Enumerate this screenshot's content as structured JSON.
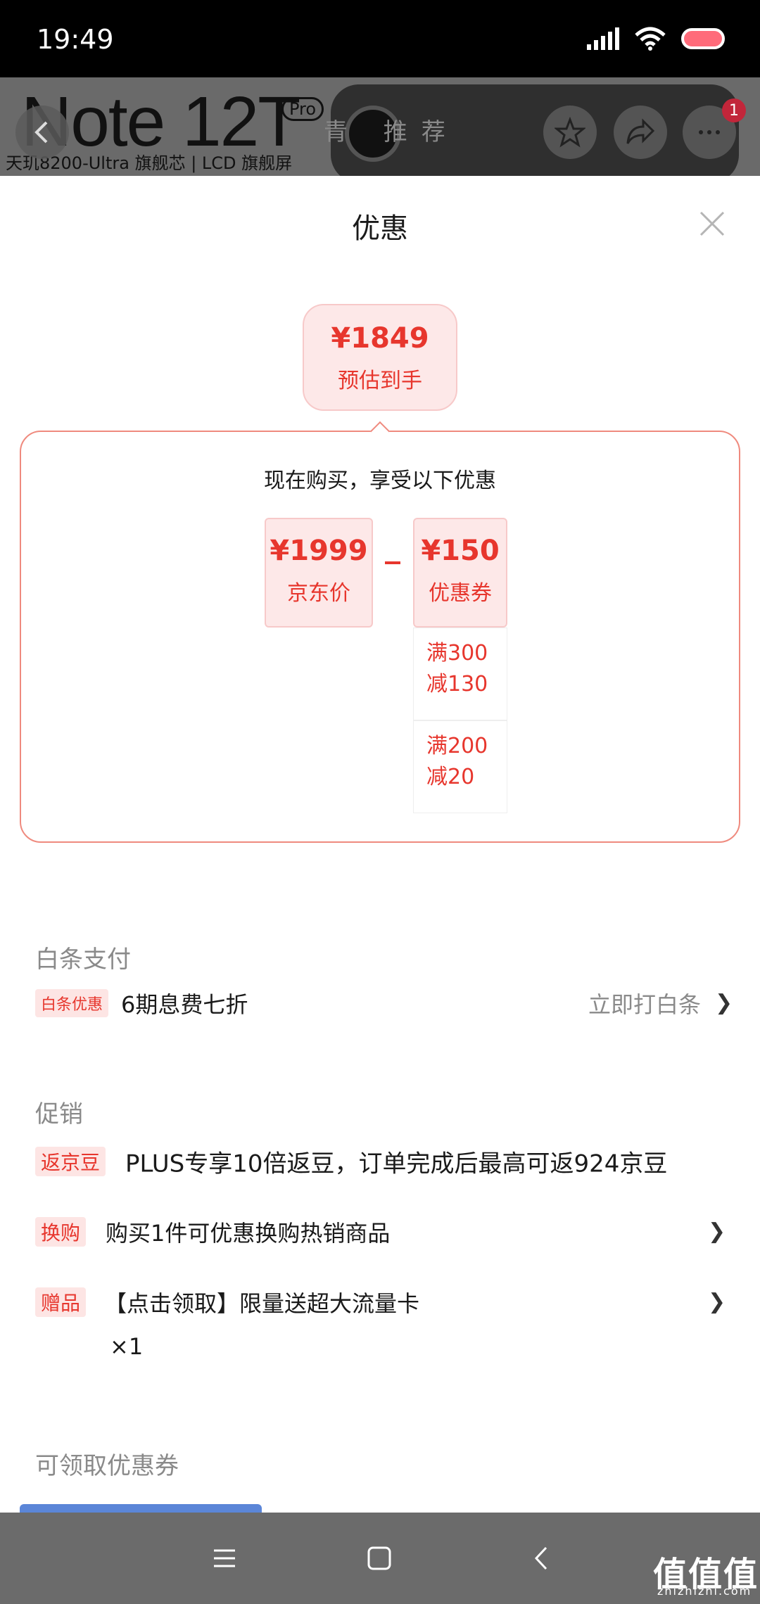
{
  "status_bar": {
    "time": "19:49"
  },
  "banner": {
    "model": "Note 12T",
    "model_suffix": "Pro",
    "subtitle": "天玑8200-Ultra 旗舰芯 | LCD 旗舰屏",
    "tabs": "青   推荐",
    "cart_badge": "1"
  },
  "sheet": {
    "title": "优惠",
    "estimate": {
      "price": "¥1849",
      "label": "预估到手"
    },
    "breakdown_title": "现在购买，享受以下优惠",
    "jd_price": {
      "price": "¥1999",
      "label": "京东价"
    },
    "coupon": {
      "price": "¥150",
      "label": "优惠券"
    },
    "coupon_rules": [
      "满300\n减130",
      "满200\n减20"
    ]
  },
  "baitiao": {
    "heading": "白条支付",
    "tag": "白条优惠",
    "text": "6期息费七折",
    "action": "立即打白条"
  },
  "promotion": {
    "heading": "促销",
    "items": [
      {
        "tag": "返京豆",
        "text": "PLUS专享10倍返豆，订单完成后最高可返924京豆"
      },
      {
        "tag": "换购",
        "text": "购买1件可优惠换购热销商品"
      },
      {
        "tag": "赠品",
        "text": "【点击领取】限量送超大流量卡",
        "extra": "×1"
      }
    ]
  },
  "coupons": {
    "heading": "可领取优惠券"
  },
  "watermark": {
    "brand": "值值值",
    "domain": "zhizhizhi.com"
  },
  "colors": {
    "accent": "#e7362d",
    "tag_bg": "#fde5e4",
    "nav": "#6b6b6b"
  }
}
